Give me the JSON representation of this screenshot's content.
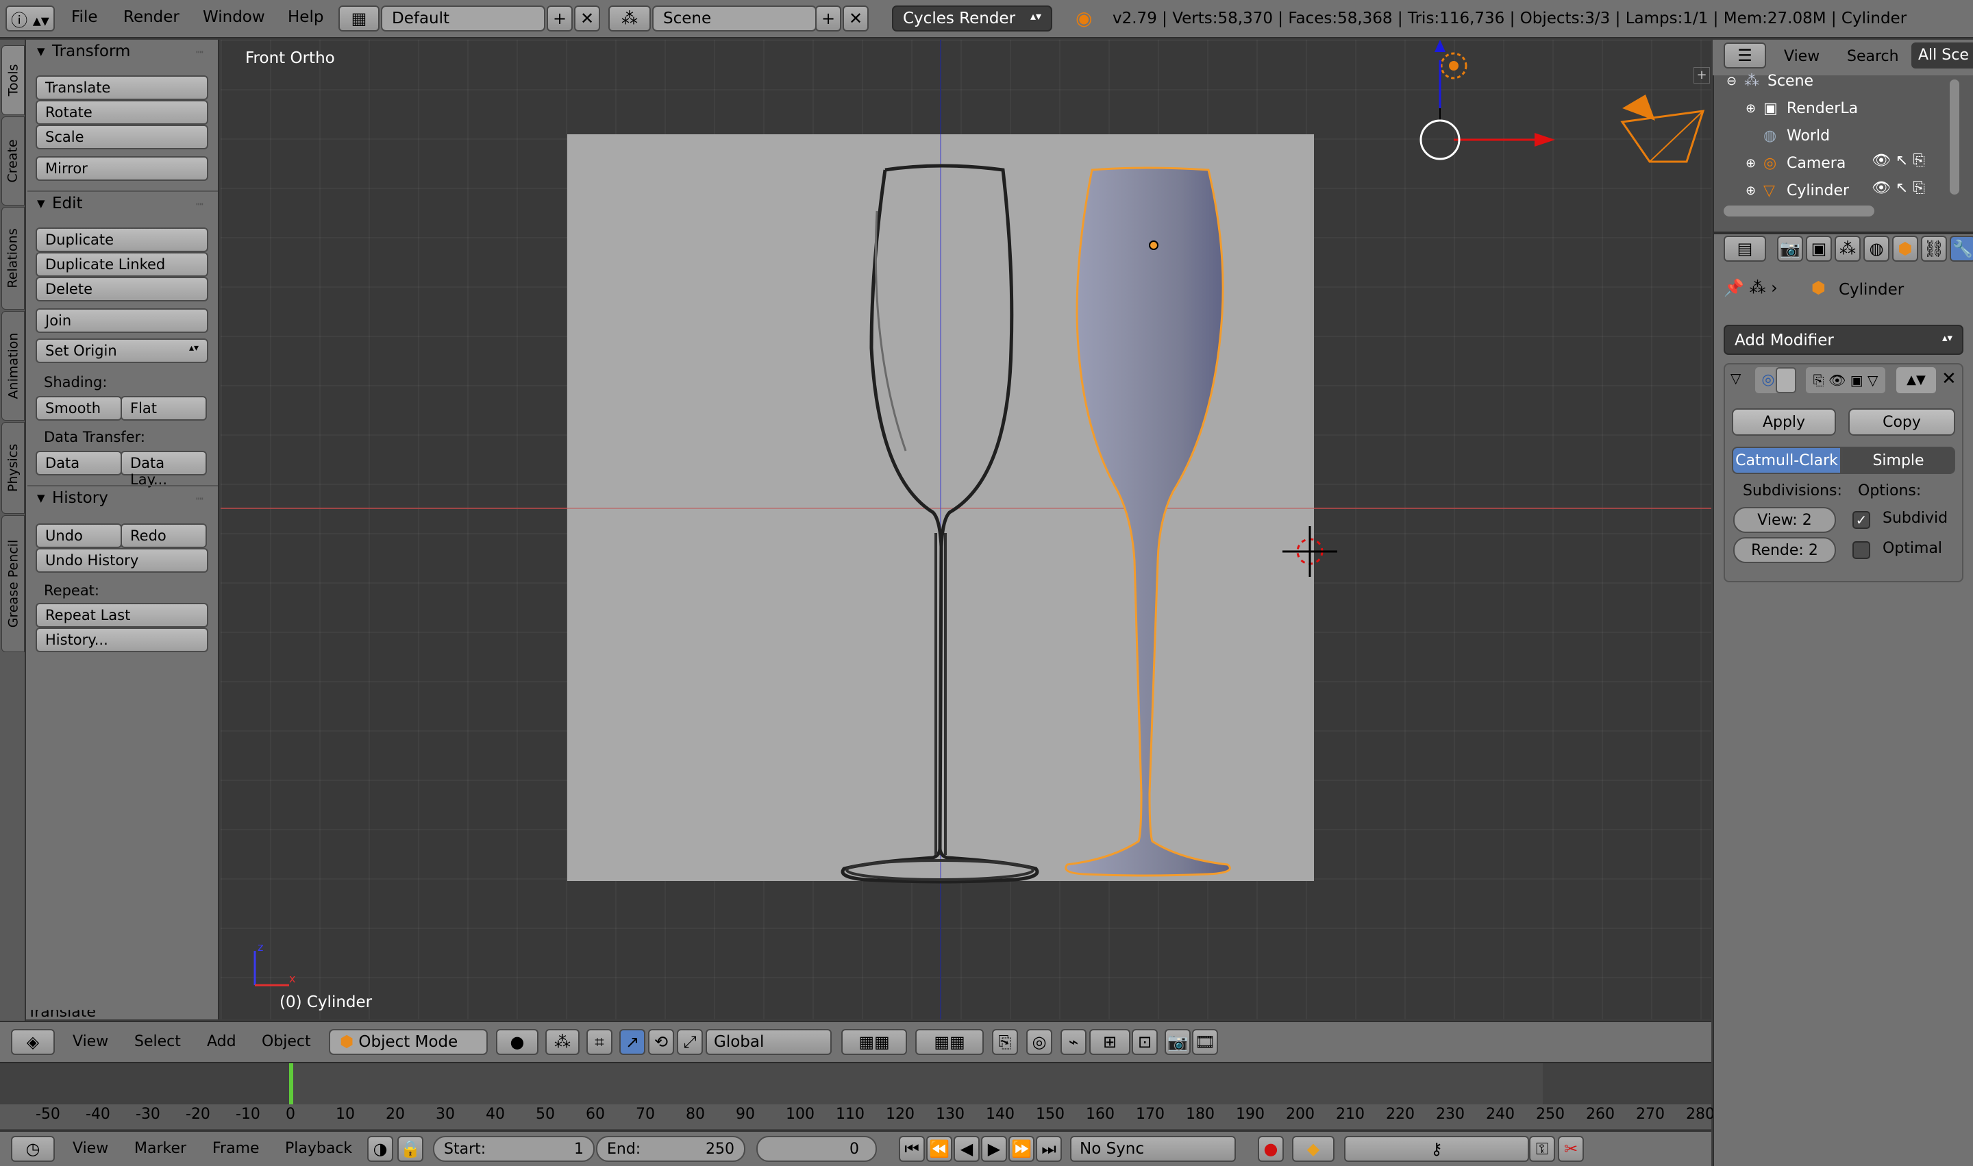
{
  "topbar": {
    "menus": [
      "File",
      "Render",
      "Window",
      "Help"
    ],
    "layout": "Default",
    "scene": "Scene",
    "engine": "Cycles Render",
    "stats": "v2.79 | Verts:58,370 | Faces:58,368 | Tris:116,736 | Objects:3/3 | Lamps:1/1 | Mem:27.08M | Cylinder"
  },
  "tabs": [
    "Tools",
    "Create",
    "Relations",
    "Animation",
    "Physics",
    "Grease Pencil"
  ],
  "toolshelf": {
    "transform": {
      "title": "Transform",
      "buttons": [
        "Translate",
        "Rotate",
        "Scale",
        "Mirror"
      ]
    },
    "edit": {
      "title": "Edit",
      "buttons": [
        "Duplicate",
        "Duplicate Linked",
        "Delete",
        "Join",
        "Set Origin"
      ],
      "shading_label": "Shading:",
      "shading": [
        "Smooth",
        "Flat"
      ],
      "transfer_label": "Data Transfer:",
      "transfer": [
        "Data",
        "Data Lay..."
      ]
    },
    "history": {
      "title": "History",
      "undo": "Undo",
      "redo": "Redo",
      "undo_history": "Undo History",
      "repeat_label": "Repeat:",
      "repeat_last": "Repeat Last",
      "history": "History..."
    },
    "collapsed": "Translate"
  },
  "viewport": {
    "view_name": "Front Ortho",
    "object_label": "(0) Cylinder"
  },
  "v3d_header": {
    "menus": [
      "View",
      "Select",
      "Add",
      "Object"
    ],
    "mode": "Object Mode",
    "orientation": "Global"
  },
  "timeline": {
    "ticks": [
      "-50",
      "-40",
      "-30",
      "-20",
      "-10",
      "0",
      "10",
      "20",
      "30",
      "40",
      "50",
      "60",
      "70",
      "80",
      "90",
      "100",
      "110",
      "120",
      "130",
      "140",
      "150",
      "160",
      "170",
      "180",
      "190",
      "200",
      "210",
      "220",
      "230",
      "240",
      "250",
      "260",
      "270",
      "280"
    ],
    "menus": [
      "View",
      "Marker",
      "Frame",
      "Playback"
    ],
    "start_label": "Start:",
    "start": "1",
    "end_label": "End:",
    "end": "250",
    "current": "0",
    "sync": "No Sync"
  },
  "outliner": {
    "menus": [
      "View",
      "Search"
    ],
    "filter": "All Sce",
    "items": [
      "Scene",
      "RenderLa",
      "World",
      "Camera",
      "Cylinder"
    ]
  },
  "properties": {
    "object": "Cylinder",
    "add_modifier": "Add Modifier",
    "apply": "Apply",
    "copy": "Copy",
    "mode_a": "Catmull-Clark",
    "mode_b": "Simple",
    "subdiv_label": "Subdivisions:",
    "options_label": "Options:",
    "view": "View:  2",
    "render": "Rende: 2",
    "opt1": "Subdivid",
    "opt2": "Optimal"
  },
  "colors": {
    "accent": "#5680c2",
    "selection": "#f39c2c",
    "x_axis": "#e02020",
    "z_axis": "#2020e0"
  }
}
